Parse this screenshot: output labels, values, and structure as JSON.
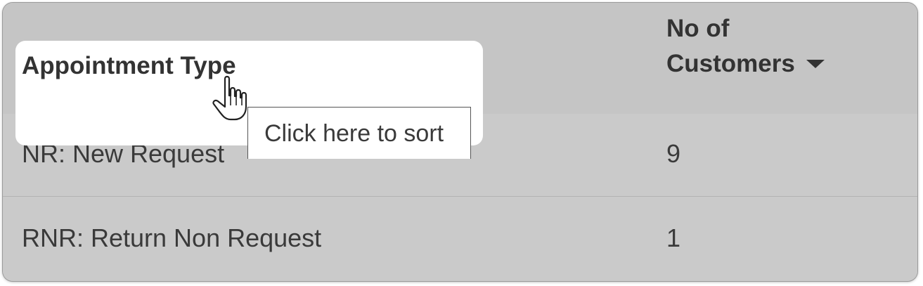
{
  "table": {
    "columns": [
      {
        "label": "Appointment Type"
      },
      {
        "label_line1": "No of",
        "label_line2": "Customers",
        "sort_direction": "descending"
      }
    ],
    "rows": [
      {
        "type": "NR: New Request",
        "count": "9"
      },
      {
        "type": "RNR: Return Non Request",
        "count": "1"
      }
    ]
  },
  "tooltip": {
    "text": "Click here to sort"
  },
  "icons": {
    "sort": "caret-down-icon",
    "cursor": "hand-pointer-icon"
  },
  "colors": {
    "background": "#cacaca",
    "header_background": "#c5c5c5",
    "highlight": "#ffffff",
    "text": "#333333"
  }
}
